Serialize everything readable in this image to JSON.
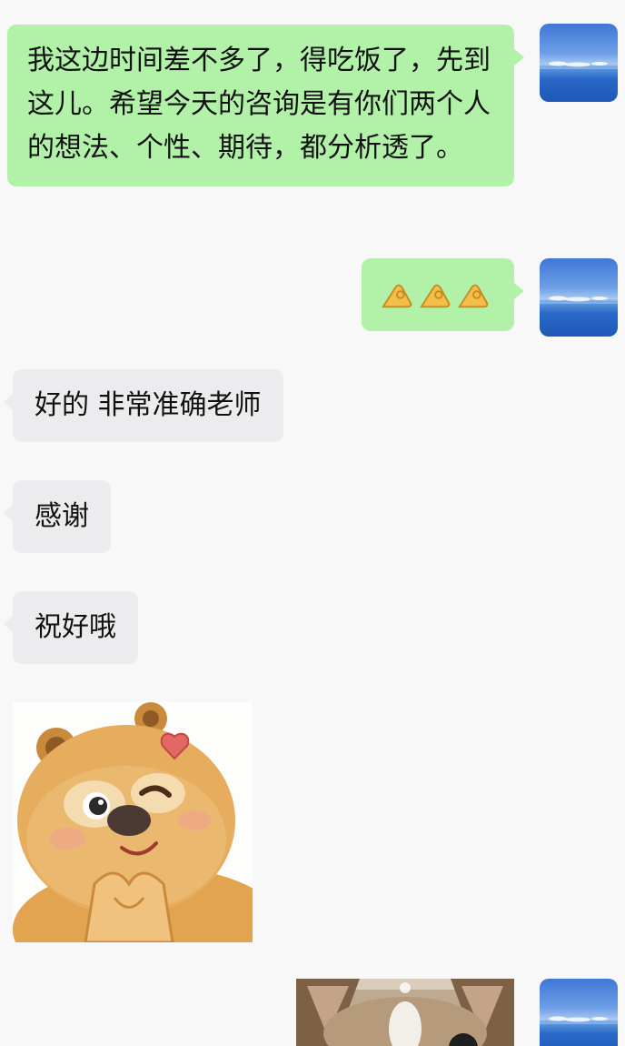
{
  "messages": [
    {
      "side": "me",
      "type": "text",
      "text": "我这边时间差不多了，得吃饭了，先到这儿。希望今天的咨询是有你们两个人的想法、个性、期待，都分析透了。"
    },
    {
      "side": "me",
      "type": "emoji",
      "emoji": [
        "👌",
        "👌",
        "👌"
      ]
    },
    {
      "side": "them",
      "type": "text",
      "text": "好的 非常准确老师"
    },
    {
      "side": "them",
      "type": "text",
      "text": "感谢"
    },
    {
      "side": "them",
      "type": "text",
      "text": "祝好哦"
    },
    {
      "side": "them",
      "type": "sticker",
      "sticker": "bear-heart-hands-sticker"
    },
    {
      "side": "me",
      "type": "image",
      "image": "cat-photo"
    }
  ],
  "avatar": {
    "icon": "sea-sky-avatar"
  },
  "colors": {
    "background": "#f8f8f8",
    "my_bubble": "#b2f2a8",
    "their_bubble": "#ececee"
  }
}
